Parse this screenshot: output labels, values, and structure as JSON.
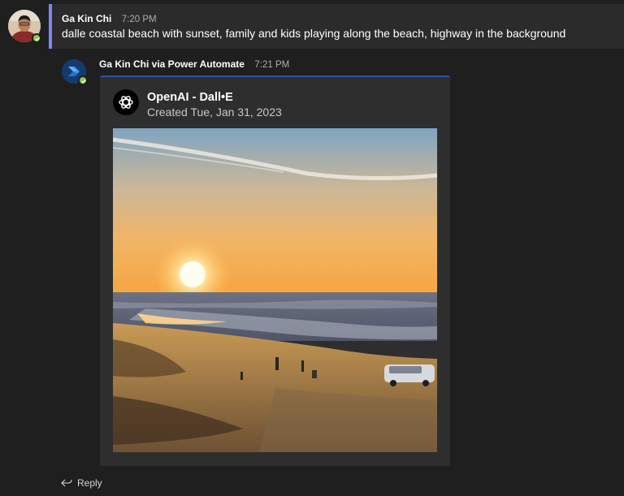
{
  "message": {
    "author": "Ga Kin Chi",
    "time": "7:20 PM",
    "text": "dalle coastal beach with sunset, family and kids playing along the beach, highway in the background"
  },
  "bot_message": {
    "author": "Ga Kin Chi via Power Automate",
    "time": "7:21 PM",
    "card": {
      "title": "OpenAI - Dall•E",
      "subtitle": "Created Tue, Jan 31, 2023",
      "image_name": "beach-sunset-image"
    }
  },
  "reply": {
    "label": "Reply"
  },
  "colors": {
    "accent": "#7f85f5",
    "presence": "#92c353",
    "card_top": "#2a53a3"
  },
  "icons": [
    "reply-arrow-icon",
    "openai-logo-icon",
    "power-automate-icon",
    "available-status-icon"
  ]
}
